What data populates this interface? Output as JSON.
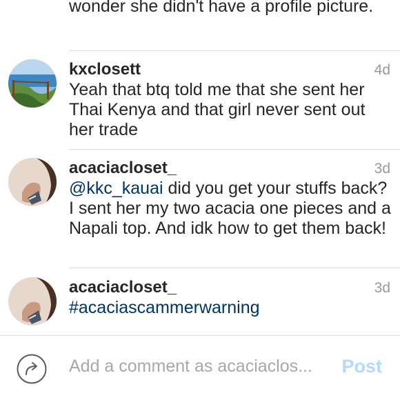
{
  "partial_comment": {
    "text": "wonder she didn't have a profile picture."
  },
  "comments": [
    {
      "username": "kxclosett",
      "time": "4d",
      "text": "Yeah that btq told me that she sent her Thai Kenya and that girl never sent out her trade"
    },
    {
      "username": "acaciacloset_",
      "time": "3d",
      "mention": "@kkc_kauai",
      "text": " did you get your stuffs back? I sent her my two acacia one pieces and a Napali top. And idk how to get them back!"
    },
    {
      "username": "acaciacloset_",
      "time": "3d",
      "hashtag": "#acaciascammerwarning"
    }
  ],
  "composer": {
    "placeholder": "Add a comment as acaciaclos...",
    "post_label": "Post",
    "icon": "reply-arrow-icon"
  },
  "colors": {
    "link": "#003569",
    "post_disabled": "#b3dbff",
    "meta": "#999999"
  }
}
